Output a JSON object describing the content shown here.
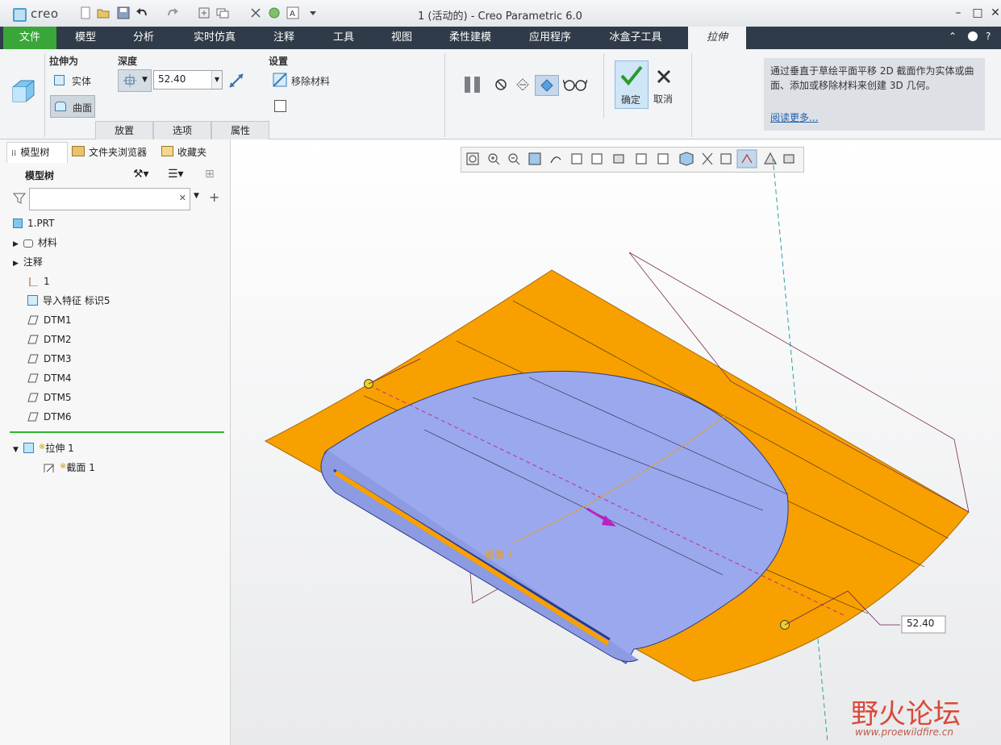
{
  "app": {
    "logo": "creo",
    "window_title": "1 (活动的) - Creo Parametric 6.0"
  },
  "menu": [
    "文件",
    "模型",
    "分析",
    "实时仿真",
    "注释",
    "工具",
    "视图",
    "柔性建模",
    "应用程序",
    "冰盒子工具",
    "拉伸"
  ],
  "ribbon": {
    "extrude_as_label": "拉伸为",
    "solid_label": "实体",
    "surface_label": "曲面",
    "depth_label": "深度",
    "depth_value": "52.40",
    "settings_label": "设置",
    "remove_material_label": "移除材料",
    "slide_tabs": [
      "放置",
      "选项",
      "属性"
    ],
    "ok_label": "确定",
    "cancel_label": "取消",
    "help_text": "通过垂直于草绘平面平移 2D 截面作为实体或曲面、添加或移除材料来创建 3D 几何。",
    "help_link": "阅读更多..."
  },
  "panel": {
    "tabs": [
      "模型树",
      "文件夹浏览器",
      "收藏夹"
    ],
    "header": "模型树",
    "tree": [
      {
        "label": "1.PRT",
        "icon": "part-icon"
      },
      {
        "label": "材料",
        "icon": "material-icon",
        "expand": true
      },
      {
        "label": "注释",
        "icon": "",
        "expand": true
      },
      {
        "label": "1",
        "icon": "csys-icon"
      },
      {
        "label": "导入特征 标识5",
        "icon": "import-icon"
      },
      {
        "label": "DTM1",
        "icon": "datum-plane-icon"
      },
      {
        "label": "DTM2",
        "icon": "datum-plane-icon"
      },
      {
        "label": "DTM3",
        "icon": "datum-plane-icon"
      },
      {
        "label": "DTM4",
        "icon": "datum-plane-icon"
      },
      {
        "label": "DTM5",
        "icon": "datum-plane-icon"
      },
      {
        "label": "DTM6",
        "icon": "datum-plane-icon"
      }
    ],
    "insert_feature": "拉伸 1",
    "insert_child": "截面 1"
  },
  "viewport": {
    "dimension_label": "52.40",
    "section_label": "截面 1"
  },
  "watermark": {
    "title": "野火论坛",
    "url": "www.proewildfire.cn"
  },
  "colors": {
    "menu_bg": "#2f3b48",
    "file_tab": "#3aa63a",
    "surface": "#f7a000",
    "solid": "#9aa8ee"
  }
}
